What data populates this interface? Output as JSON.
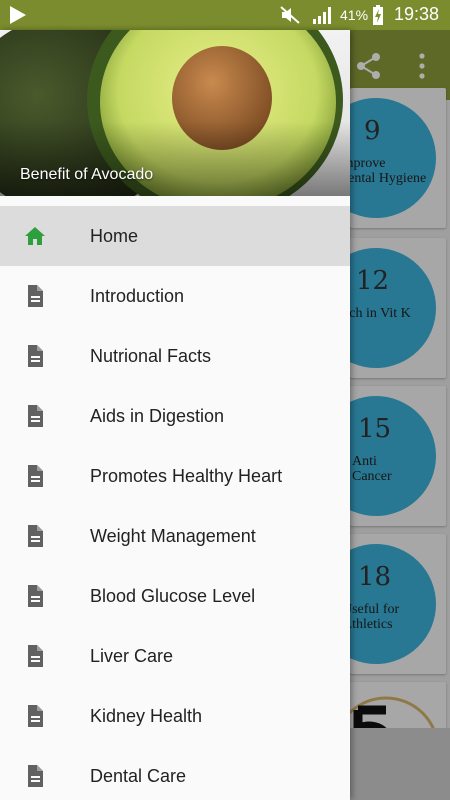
{
  "status_bar": {
    "battery_percent": "41%",
    "time": "19:38"
  },
  "background_cards": [
    {
      "number": "9",
      "caption": "Improve\nDental Hygiene"
    },
    {
      "number": "12",
      "caption": "Rich in Vit K"
    },
    {
      "number": "15",
      "caption": "Anti\nCancer"
    },
    {
      "number": "18",
      "caption": "Useful for\nAthletics"
    }
  ],
  "drawer": {
    "header_title": "Benefit of Avocado",
    "items": [
      {
        "label": "Home",
        "icon": "home-icon",
        "active": true
      },
      {
        "label": "Introduction",
        "icon": "document-icon"
      },
      {
        "label": "Nutrional Facts",
        "icon": "document-icon"
      },
      {
        "label": "Aids in Digestion",
        "icon": "document-icon"
      },
      {
        "label": "Promotes Healthy Heart",
        "icon": "document-icon"
      },
      {
        "label": "Weight Management",
        "icon": "document-icon"
      },
      {
        "label": "Blood Glucose Level",
        "icon": "document-icon"
      },
      {
        "label": "Liver Care",
        "icon": "document-icon"
      },
      {
        "label": "Kidney Health",
        "icon": "document-icon"
      },
      {
        "label": "Dental Care",
        "icon": "document-icon"
      }
    ]
  },
  "colors": {
    "status_bar": "#7b8c2e",
    "toolbar": "#8b9a3a",
    "home_icon": "#2e9e3f",
    "document_icon": "#616161",
    "card_circle": "#3bb0d9"
  }
}
